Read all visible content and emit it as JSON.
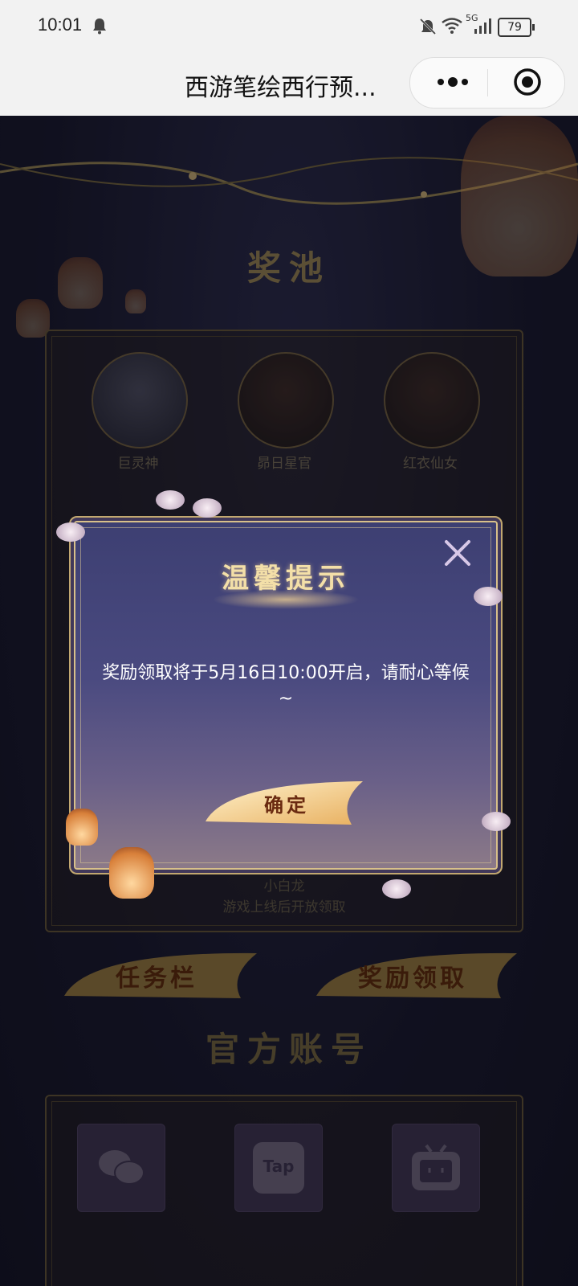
{
  "status_bar": {
    "time": "10:01",
    "battery": "79",
    "network": "5G"
  },
  "title_bar": {
    "title": "西游笔绘西行预..."
  },
  "pool": {
    "heading": "奖池",
    "characters": [
      {
        "name": "巨灵神"
      },
      {
        "name": "昴日星官"
      },
      {
        "name": "红衣仙女"
      }
    ],
    "featured": {
      "name": "小白龙",
      "note": "游戏上线后开放领取"
    }
  },
  "buttons": {
    "tasks": "任务栏",
    "rewards": "奖励领取"
  },
  "official": {
    "heading": "官方账号",
    "tap_label": "Tap"
  },
  "dialog": {
    "title": "温馨提示",
    "message": "奖励领取将于5月16日10:00开启，请耐心等候~",
    "confirm": "确定"
  },
  "colors": {
    "gold": "#d8c08a",
    "dialog_bg": "#3d3f72",
    "page_bg": "#1c1c34"
  }
}
